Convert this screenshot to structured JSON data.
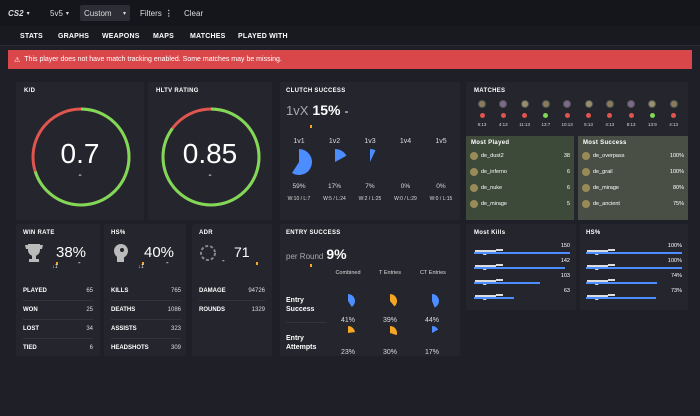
{
  "topbar": {
    "logo": "CS2",
    "mode": "5v5",
    "filter_select": "Custom",
    "filters_label": "Filters",
    "clear_label": "Clear"
  },
  "nav": {
    "tabs": [
      "STATS",
      "GRAPHS",
      "WEAPONS",
      "MAPS",
      "MATCHES",
      "PLAYED WITH"
    ]
  },
  "alert": {
    "text": "This player does not have match tracking enabled. Some matches may be missing."
  },
  "kd": {
    "title": "K/D",
    "value": "0.7",
    "sub": "-",
    "fraction": 0.7
  },
  "hltv": {
    "title": "HLTV RATING",
    "value": "0.85",
    "sub": "-",
    "fraction": 0.85
  },
  "clutch": {
    "title": "CLUTCH SUCCESS",
    "label": "1vX",
    "value": "15%",
    "dash": "-",
    "cols": [
      {
        "name": "1v1",
        "pct": "59%",
        "wl": "W:10 / L:7",
        "fraction": 0.59
      },
      {
        "name": "1v2",
        "pct": "17%",
        "wl": "W:5 / L:24",
        "fraction": 0.17
      },
      {
        "name": "1v3",
        "pct": "7%",
        "wl": "W:2 / L:25",
        "fraction": 0.07
      },
      {
        "name": "1v4",
        "pct": "0%",
        "wl": "W:0 / L:29",
        "fraction": 0
      },
      {
        "name": "1v5",
        "pct": "0%",
        "wl": "W:0 / L:15",
        "fraction": 0
      }
    ]
  },
  "matches": {
    "title": "MATCHES",
    "scores": [
      "9:13",
      "4:13",
      "11:13",
      "13:7",
      "10:13",
      "5:13",
      "4:13",
      "8:13",
      "13:9",
      "4:13"
    ],
    "results": [
      "loss",
      "loss",
      "loss",
      "win",
      "loss",
      "loss",
      "loss",
      "loss",
      "win",
      "loss"
    ]
  },
  "most_played": {
    "title": "Most Played",
    "rows": [
      {
        "map": "de_dust2",
        "value": "38"
      },
      {
        "map": "de_inferno",
        "value": "6"
      },
      {
        "map": "de_nuke",
        "value": "6"
      },
      {
        "map": "de_mirage",
        "value": "5"
      }
    ]
  },
  "most_success": {
    "title": "Most Success",
    "rows": [
      {
        "map": "de_overpass",
        "value": "100%"
      },
      {
        "map": "de_grail",
        "value": "100%"
      },
      {
        "map": "de_mirage",
        "value": "80%"
      },
      {
        "map": "de_ancient",
        "value": "75%"
      }
    ]
  },
  "winrate": {
    "title": "WIN RATE",
    "value": "38%",
    "sub": "-",
    "arrow": "1",
    "rows": [
      {
        "label": "PLAYED",
        "value": "65"
      },
      {
        "label": "WON",
        "value": "25"
      },
      {
        "label": "LOST",
        "value": "34"
      },
      {
        "label": "TIED",
        "value": "6"
      }
    ]
  },
  "hs": {
    "title": "HS%",
    "value": "40%",
    "sub": "-",
    "arrow": "1",
    "rows": [
      {
        "label": "KILLS",
        "value": "765"
      },
      {
        "label": "DEATHS",
        "value": "1086"
      },
      {
        "label": "ASSISTS",
        "value": "323"
      },
      {
        "label": "HEADSHOTS",
        "value": "309"
      }
    ]
  },
  "adr": {
    "title": "ADR",
    "value": "71",
    "sub": "-",
    "rows": [
      {
        "label": "DAMAGE",
        "value": "94726"
      },
      {
        "label": "ROUNDS",
        "value": "1329"
      }
    ]
  },
  "entry": {
    "title": "ENTRY SUCCESS",
    "label": "per Round",
    "value": "9%",
    "headers": [
      "Combined",
      "T Entries",
      "CT Entries"
    ],
    "success_label": "Entry Success",
    "attempts_label": "Entry Attempts",
    "success": [
      {
        "pct": "41%",
        "fraction": 0.41
      },
      {
        "pct": "39%",
        "fraction": 0.39
      },
      {
        "pct": "44%",
        "fraction": 0.44
      }
    ],
    "attempts": [
      {
        "pct": "23%",
        "fraction": 0.23
      },
      {
        "pct": "30%",
        "fraction": 0.3
      },
      {
        "pct": "17%",
        "fraction": 0.17
      }
    ]
  },
  "most_kills": {
    "title": "Most Kills",
    "rows": [
      {
        "value": "150",
        "fraction": 1.0
      },
      {
        "value": "142",
        "fraction": 0.95
      },
      {
        "value": "103",
        "fraction": 0.69
      },
      {
        "value": "63",
        "fraction": 0.42
      }
    ]
  },
  "hs_weapons": {
    "title": "HS%",
    "rows": [
      {
        "value": "100%",
        "fraction": 1.0
      },
      {
        "value": "100%",
        "fraction": 1.0
      },
      {
        "value": "74%",
        "fraction": 0.74
      },
      {
        "value": "73%",
        "fraction": 0.73
      }
    ]
  },
  "colors": {
    "accent": "#4c8dff",
    "win": "#7ed957",
    "loss": "#e0554e",
    "orange": "#f5a623",
    "alert": "#d9474b"
  }
}
